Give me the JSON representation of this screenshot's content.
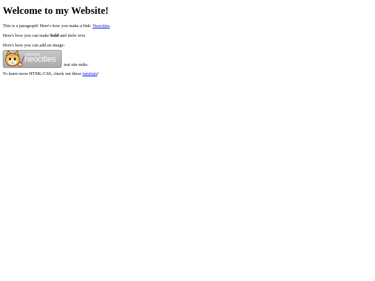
{
  "page": {
    "heading": "Welcome to my Website!",
    "paragraph1": {
      "before": "This is a paragraph! Here's how you make a link: ",
      "link_text": "Neocities",
      "after": "."
    },
    "paragraph2": {
      "before": "Here's how you can make ",
      "bold": "bold",
      "middle": " and ",
      "italic": "italic",
      "after": " text."
    },
    "paragraph3": "Here's how you can add an image:",
    "image": {
      "alt": "hosted by neocities",
      "small_text": "hosted by",
      "big_text": "neocities",
      "caption": "test site miks"
    },
    "paragraph5": {
      "before": "To learn more HTML/CSS, check out these ",
      "link_text": "tutorials",
      "after": "!"
    }
  }
}
